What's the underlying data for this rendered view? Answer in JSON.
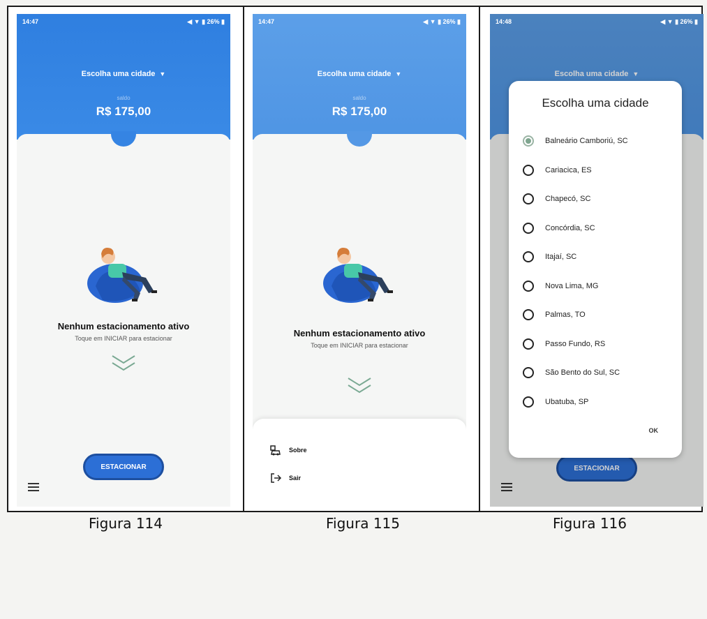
{
  "screens": [
    {
      "status_time": "14:47",
      "status_icons": "◀ ▼ ▮ 26% ▮",
      "city_select": "Escolha uma cidade",
      "balance": "R$ 175,00",
      "empty_title": "Nenhum estacionamento ativo",
      "empty_subtitle": "Toque em INICIAR para estacionar",
      "park_button": "ESTACIONAR"
    },
    {
      "status_time": "14:47",
      "status_icons": "◀ ▼ ▮ 26% ▮",
      "city_select": "Escolha uma cidade",
      "balance": "R$ 175,00",
      "empty_title": "Nenhum estacionamento ativo",
      "empty_subtitle": "Toque em INICIAR para estacionar",
      "drawer_items": [
        {
          "label": "Sobre",
          "icon": "car-info-icon"
        },
        {
          "label": "Sair",
          "icon": "logout-icon"
        }
      ]
    },
    {
      "status_time": "14:48",
      "status_icons": "◀ ▼ ▮ 26% ▮",
      "city_select": "Escolha uma cidade",
      "park_button": "ESTACIONAR",
      "dialog": {
        "title": "Escolha uma cidade",
        "selected_index": 0,
        "cities": [
          "Balneário Camboriú, SC",
          "Cariacica, ES",
          "Chapecó, SC",
          "Concórdia, SC",
          "Itajaí, SC",
          "Nova Lima, MG",
          "Palmas, TO",
          "Passo Fundo, RS",
          "São Bento  do Sul, SC",
          "Ubatuba, SP"
        ],
        "ok": "OK"
      }
    }
  ],
  "captions": [
    "Figura 114",
    "Figura 115",
    "Figura 116"
  ],
  "colors": {
    "header_blue": "#2f7fe0",
    "button_blue": "#2c6fd6",
    "selected_radio": "#7fa58f"
  }
}
